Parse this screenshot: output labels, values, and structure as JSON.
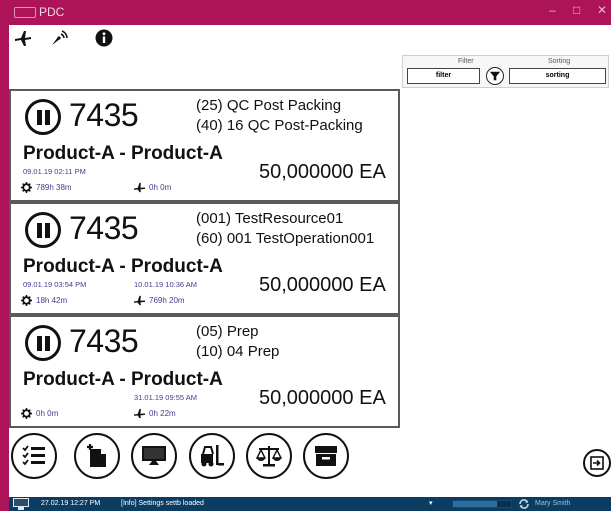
{
  "window": {
    "title": "PDC",
    "controls": {
      "minimize": "–",
      "maximize": "□",
      "close": "✕"
    }
  },
  "toolbar": {
    "icons": [
      "plane-icon",
      "signal-icon",
      "info-icon"
    ]
  },
  "filter_panel": {
    "filter_label": "Filter",
    "sorting_label": "Sorting",
    "filter_value": "filter",
    "sorting_value": "sorting"
  },
  "cards": [
    {
      "order": "7435",
      "op1": "(25) QC Post Packing",
      "op2": "(40) 16 QC Post-Packing",
      "product": "Product-A - Product-A",
      "date1": "09.01.19 02:11 PM",
      "date2": "",
      "hours1": "789h 38m",
      "hours2": "0h 0m",
      "quantity": "50,000000 EA"
    },
    {
      "order": "7435",
      "op1": "(001) TestResource01",
      "op2": "(60) 001 TestOperation001",
      "product": "Product-A - Product-A",
      "date1": "09.01.19 03:54 PM",
      "date2": "10.01.19 10:36 AM",
      "hours1": "18h 42m",
      "hours2": "769h 20m",
      "quantity": "50,000000 EA"
    },
    {
      "order": "7435",
      "op1": "(05) Prep",
      "op2": "(10) 04 Prep",
      "product": "Product-A - Product-A",
      "date1": "",
      "date2": "31.01.19 09:55 AM",
      "hours1": "0h 0m",
      "hours2": "0h 22m",
      "quantity": "50,000000 EA"
    }
  ],
  "footer_buttons": [
    "checklist-icon",
    "document-add-icon",
    "monitor-icon",
    "forklift-icon",
    "scale-icon",
    "archive-icon"
  ],
  "status": {
    "time": "27.02.19 12:27 PM",
    "message": "[Info]  Settings settb loaded",
    "dropdown": "▾",
    "progress": 0.75,
    "user": "Mary Smith"
  },
  "colors": {
    "accent": "#ad1457",
    "statusbar": "#0b3d63",
    "secondary_text": "#4a3a8a"
  }
}
